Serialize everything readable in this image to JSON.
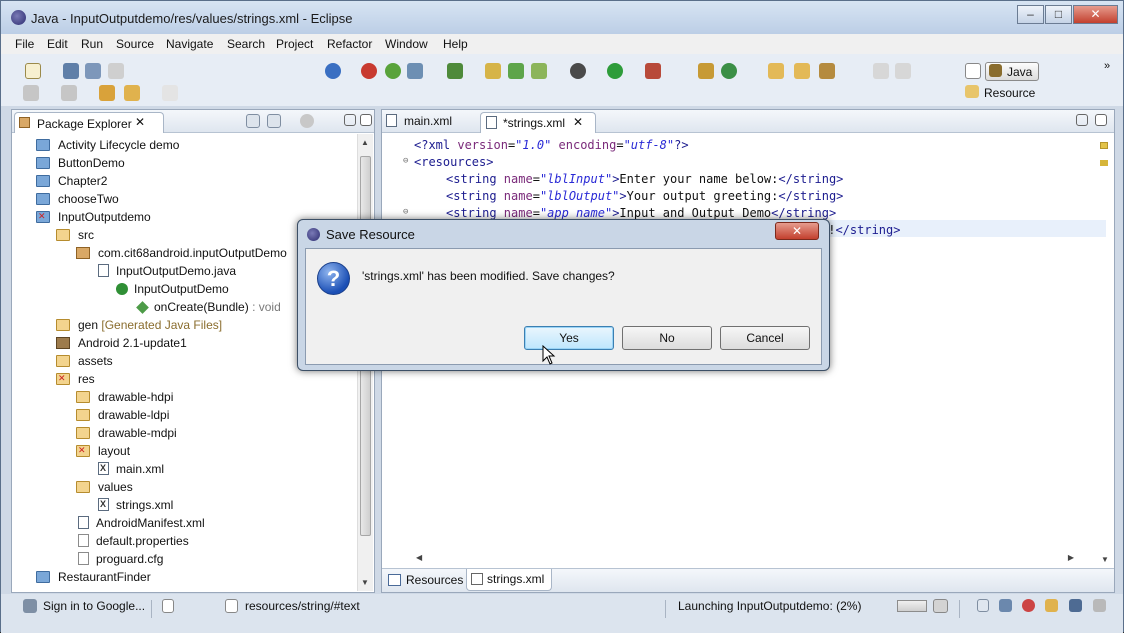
{
  "window": {
    "title": "Java - InputOutputdemo/res/values/strings.xml - Eclipse"
  },
  "window_controls": [
    "–",
    "□",
    "✕"
  ],
  "menu": [
    "File",
    "Edit",
    "Run",
    "Source",
    "Navigate",
    "Search",
    "Project",
    "Refactor",
    "Window",
    "Help"
  ],
  "perspectives": {
    "java": "Java",
    "resource": "Resource",
    "more": "»"
  },
  "package_explorer": {
    "title": "Package Explorer",
    "close": "✕",
    "tree": [
      {
        "label": "Activity Lifecycle demo",
        "extra": "",
        "icon": "project"
      },
      {
        "label": "ButtonDemo",
        "extra": "",
        "icon": "project"
      },
      {
        "label": "Chapter2",
        "extra": "",
        "icon": "project"
      },
      {
        "label": "chooseTwo",
        "extra": "",
        "icon": "project"
      },
      {
        "label": "InputOutputdemo",
        "extra": "",
        "icon": "project"
      },
      {
        "label": "src",
        "extra": "",
        "icon": "folder"
      },
      {
        "label": "com.cit68android.inputOutputDemo",
        "extra": "",
        "icon": "package"
      },
      {
        "label": "InputOutputDemo.java",
        "extra": "",
        "icon": "java-file"
      },
      {
        "label": "InputOutputDemo",
        "extra": "",
        "icon": "class"
      },
      {
        "label": "onCreate(Bundle)",
        "extra": " : void",
        "icon": "method"
      },
      {
        "label": "gen",
        "extra": " [Generated Java Files]",
        "icon": "folder"
      },
      {
        "label": "Android 2.1-update1",
        "extra": "",
        "icon": "library"
      },
      {
        "label": "assets",
        "extra": "",
        "icon": "folder"
      },
      {
        "label": "res",
        "extra": "",
        "icon": "folder"
      },
      {
        "label": "drawable-hdpi",
        "extra": "",
        "icon": "folder"
      },
      {
        "label": "drawable-ldpi",
        "extra": "",
        "icon": "folder"
      },
      {
        "label": "drawable-mdpi",
        "extra": "",
        "icon": "folder"
      },
      {
        "label": "layout",
        "extra": "",
        "icon": "folder"
      },
      {
        "label": "main.xml",
        "extra": "",
        "icon": "xml-file"
      },
      {
        "label": "values",
        "extra": "",
        "icon": "folder"
      },
      {
        "label": "strings.xml",
        "extra": "",
        "icon": "xml-file"
      },
      {
        "label": "AndroidManifest.xml",
        "extra": "",
        "icon": "xml-file"
      },
      {
        "label": "default.properties",
        "extra": "",
        "icon": "file"
      },
      {
        "label": "proguard.cfg",
        "extra": "",
        "icon": "file"
      },
      {
        "label": "RestaurantFinder",
        "extra": "",
        "icon": "project"
      }
    ]
  },
  "editor": {
    "tabs": [
      {
        "label": "main.xml"
      },
      {
        "label": "*strings.xml",
        "close": "✕"
      }
    ],
    "code": {
      "decl": {
        "open": "<?xml ",
        "a1": "version",
        "eq1": "=",
        "v1": "\"1.0\"",
        "sp": " ",
        "a2": "encoding",
        "eq2": "=",
        "v2": "\"utf-8\"",
        "close": "?>"
      },
      "resources_open": "<resources>",
      "strings": [
        {
          "open": "<string ",
          "attr": "name",
          "eq": "=",
          "value": "\"lblInput\"",
          "gt": ">",
          "text": "Enter your name below:",
          "close": "</string>"
        },
        {
          "open": "<string ",
          "attr": "name",
          "eq": "=",
          "value": "\"lblOutput\"",
          "gt": ">",
          "text": "Your output greeting:",
          "close": "</string>"
        },
        {
          "open": "<string ",
          "attr": "name",
          "eq": "=",
          "value": "\"app_name\"",
          "gt": ">",
          "text": "Input and Output Demo",
          "close": "</string>"
        }
      ],
      "fragment": {
        "text": "g!",
        "close": "</string>"
      }
    },
    "bottom_tabs": [
      "Resources",
      "strings.xml"
    ]
  },
  "statusbar": {
    "sign_in": "Sign in to Google...",
    "path": "resources/string/#text",
    "progress": "Launching InputOutputdemo: (2%)"
  },
  "dialog": {
    "title": "Save Resource",
    "close": "✕",
    "icon_glyph": "?",
    "message": "'strings.xml' has been modified. Save changes?",
    "buttons": {
      "yes": "Yes",
      "no": "No",
      "cancel": "Cancel"
    }
  },
  "colors": {
    "xml_tag": "#1c1c8f",
    "xml_attr": "#7a2a7a",
    "xml_value": "#2a2ad6",
    "close_red": "#c3402e"
  }
}
